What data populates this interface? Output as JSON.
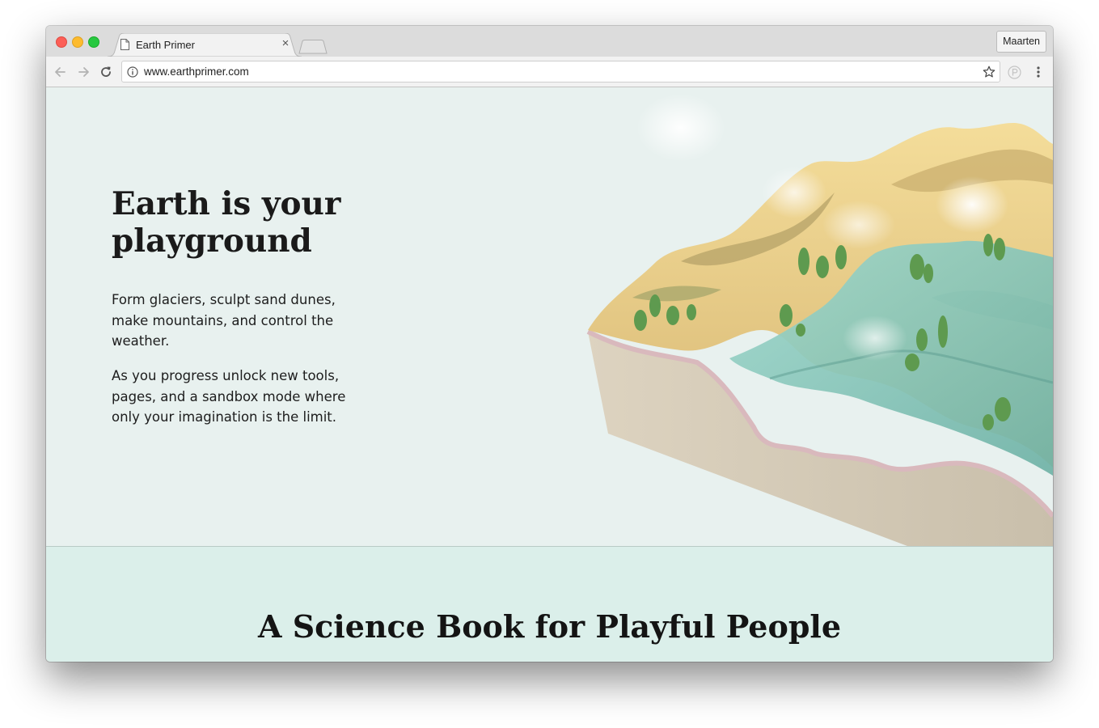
{
  "browser": {
    "tab_title": "Earth Primer",
    "tab_close_glyph": "×",
    "profile_name": "Maarten",
    "url": "www.earthprimer.com",
    "icons": [
      "back-icon",
      "forward-icon",
      "reload-icon",
      "info-icon",
      "bookmark-star-icon",
      "extension-icon",
      "menu-icon",
      "page-icon"
    ]
  },
  "hero": {
    "title": "Earth is your playground",
    "paragraph1": "Form glaciers, sculpt sand dunes, make mountains, and control the weather.",
    "paragraph2": "As you progress unlock new tools, pages, and a sandbox mode where only your imagination is the limit."
  },
  "section2": {
    "title": "A Science Book for Playful People"
  },
  "colors": {
    "hero_bg": "#e8f1ef",
    "section2_bg": "#dbefea",
    "text": "#1a1a1a",
    "terrain_sand": "#e8cf8c",
    "terrain_water": "#8fcfc1",
    "terrain_soil": "#d4cbb8"
  }
}
